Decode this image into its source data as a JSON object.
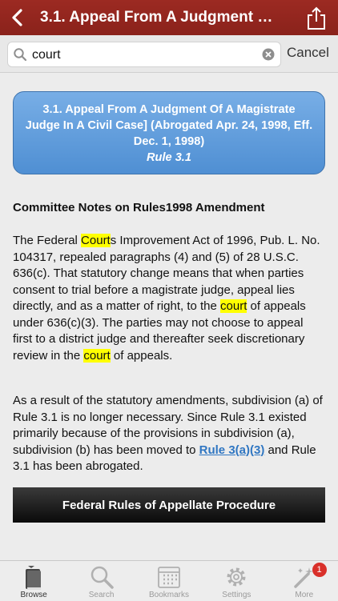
{
  "nav": {
    "back_glyph": "<",
    "title": "3.1. Appeal From A Judgment Of A Magistrate Judge In A Civil Case] (Abrogated Apr. 24, 1998, Eff. Dec. 1, 1998)"
  },
  "search": {
    "value": "court",
    "placeholder": "",
    "cancel_label": "Cancel"
  },
  "rule_header": {
    "title": "3.1. Appeal From A Judgment Of A Magistrate Judge In A Civil Case] (Abrogated Apr. 24, 1998, Eff. Dec. 1, 1998)",
    "rule_number": "Rule 3.1"
  },
  "notes": {
    "heading": "Committee Notes on Rules1998 Amendment",
    "p1_a": "The Federal ",
    "p1_hl1": "Court",
    "p1_b": "s Improvement Act of 1996, Pub. L. No. 104317, repealed paragraphs (4) and (5) of 28 U.S.C. 636(c). That statutory change means that when parties consent to trial before a magistrate judge, appeal lies directly, and as a matter of right, to the ",
    "p1_hl2": "court",
    "p1_c": " of appeals under 636(c)(3). The parties may not choose to appeal first to a district judge and thereafter seek discretionary review in the ",
    "p1_hl3": "court",
    "p1_d": " of appeals.",
    "p2_a": "As a result of the statutory amendments, subdivision (a) of Rule 3.1 is no longer necessary. Since Rule 3.1 existed primarily because of the provisions in subdivision (a), subdivision (b) has been moved to ",
    "p2_link": "Rule 3(a)(3)",
    "p2_b": " and Rule 3.1 has been abrogated."
  },
  "frap_button": "Federal Rules of Appellate Procedure",
  "tabs": [
    {
      "label": "Browse",
      "icon": "book-icon"
    },
    {
      "label": "Search",
      "icon": "search-icon"
    },
    {
      "label": "Bookmarks",
      "icon": "calendar-icon"
    },
    {
      "label": "Settings",
      "icon": "gear-icon"
    },
    {
      "label": "More",
      "icon": "magic-wand-icon",
      "badge": "1"
    }
  ],
  "colors": {
    "nav_bar": "#9c2a22",
    "rule_header": "#4f8fd3",
    "highlight": "#ffff00",
    "link": "#2f76c2",
    "badge": "#d9302a"
  }
}
